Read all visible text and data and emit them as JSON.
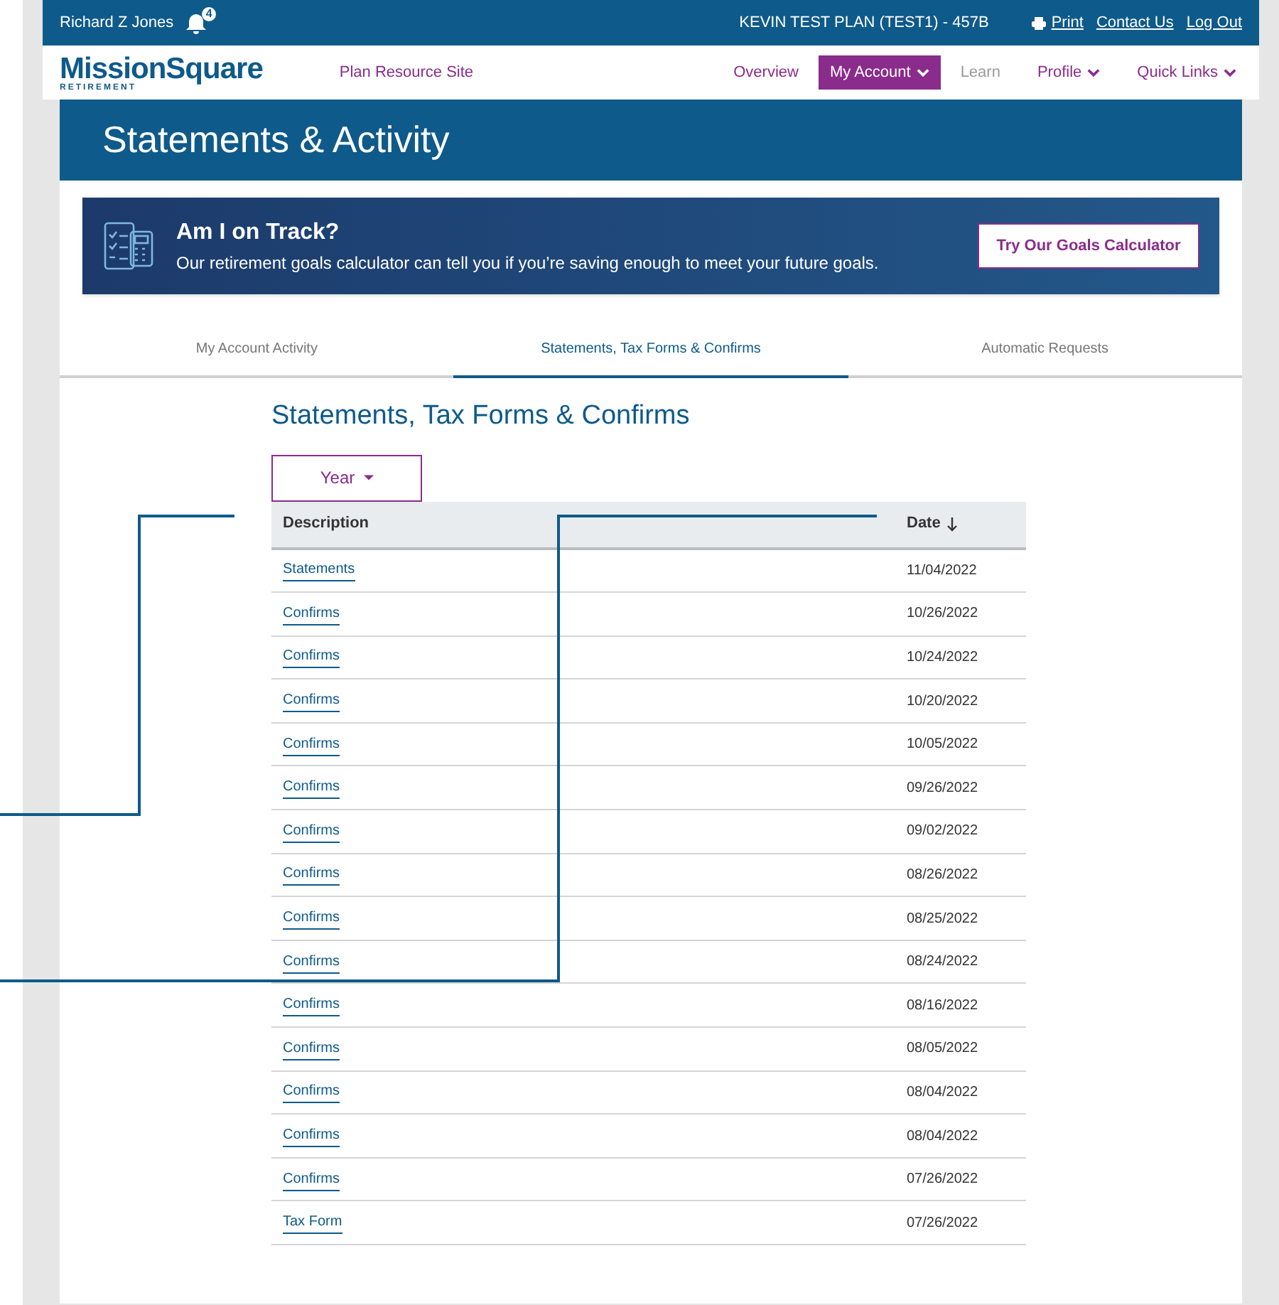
{
  "top_bar": {
    "user": "Richard Z Jones",
    "notification_count": "4",
    "plan": "KEVIN TEST PLAN (TEST1) - 457B",
    "links": [
      "Print",
      "Contact Us",
      "Log Out"
    ]
  },
  "nav": {
    "logo": "MissionSquare",
    "logo_sub": "RETIREMENT",
    "resource_link": "Plan Resource Site",
    "items": [
      {
        "label": "Overview",
        "selected": false,
        "dropdown": false,
        "disabled": false
      },
      {
        "label": "My Account",
        "selected": true,
        "dropdown": true,
        "disabled": false
      },
      {
        "label": "Learn",
        "selected": false,
        "dropdown": false,
        "disabled": true
      },
      {
        "label": "Profile",
        "selected": false,
        "dropdown": true,
        "disabled": false
      },
      {
        "label": "Quick Links",
        "selected": false,
        "dropdown": true,
        "disabled": false
      }
    ]
  },
  "page_title": "Statements & Activity",
  "banner": {
    "title": "Am I on Track?",
    "text": "Our retirement goals calculator can tell you if you’re saving enough to meet your future goals.",
    "button": "Try Our Goals Calculator"
  },
  "tabs": [
    {
      "label": "My Account Activity",
      "selected": false
    },
    {
      "label": "Statements, Tax Forms & Confirms",
      "selected": true
    },
    {
      "label": "Automatic Requests",
      "selected": false
    }
  ],
  "section_title": "Statements, Tax Forms & Confirms",
  "filter": {
    "label": "Year"
  },
  "table": {
    "columns": [
      "Description",
      "Date"
    ],
    "rows": [
      [
        "Statements",
        "11/04/2022"
      ],
      [
        "Confirms",
        "10/26/2022"
      ],
      [
        "Confirms",
        "10/24/2022"
      ],
      [
        "Confirms",
        "10/20/2022"
      ],
      [
        "Confirms",
        "10/05/2022"
      ],
      [
        "Confirms",
        "09/26/2022"
      ],
      [
        "Confirms",
        "09/02/2022"
      ],
      [
        "Confirms",
        "08/26/2022"
      ],
      [
        "Confirms",
        "08/25/2022"
      ],
      [
        "Confirms",
        "08/24/2022"
      ],
      [
        "Confirms",
        "08/16/2022"
      ],
      [
        "Confirms",
        "08/05/2022"
      ],
      [
        "Confirms",
        "08/04/2022"
      ],
      [
        "Confirms",
        "08/04/2022"
      ],
      [
        "Confirms",
        "07/26/2022"
      ],
      [
        "Tax Form",
        "07/26/2022"
      ]
    ]
  }
}
